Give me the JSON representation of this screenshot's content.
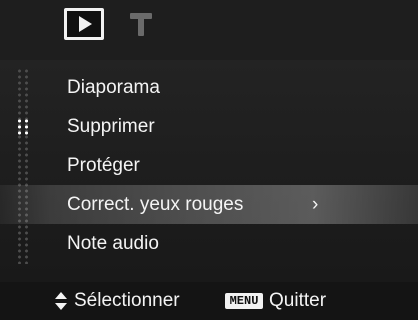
{
  "tabs": [
    {
      "icon": "playback-icon",
      "active": true
    },
    {
      "icon": "setup-hammer-icon",
      "active": false
    }
  ],
  "menu": {
    "items": [
      {
        "label": "Diaporama"
      },
      {
        "label": "Supprimer"
      },
      {
        "label": "Protéger"
      },
      {
        "label": "Correct. yeux rouges",
        "arrow": "›",
        "selected": true
      },
      {
        "label": "Note audio"
      }
    ]
  },
  "footer": {
    "select_label": "Sélectionner",
    "menu_key": "MENU",
    "quit_label": "Quitter"
  }
}
